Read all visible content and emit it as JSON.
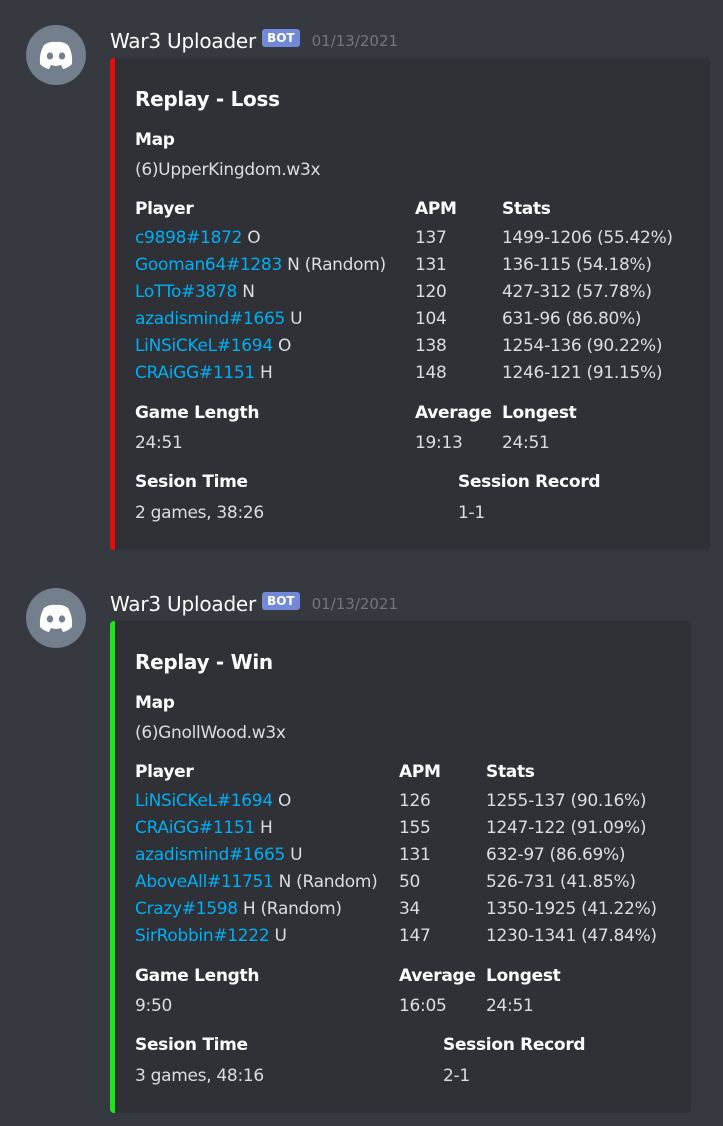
{
  "messages": [
    {
      "username": "War3 Uploader",
      "bot_tag": "BOT",
      "timestamp": "01/13/2021",
      "embed": {
        "color": "#e30f0f",
        "title": "Replay - Loss",
        "map_label": "Map",
        "map": "(6)UpperKingdom.w3x",
        "player_label": "Player",
        "apm_label": "APM",
        "stats_label": "Stats",
        "players": [
          {
            "name": "c9898#1872",
            "race": "O",
            "apm": "137",
            "stats": "1499-1206 (55.42%)"
          },
          {
            "name": "Gooman64#1283",
            "race": "N (Random)",
            "apm": "131",
            "stats": "136-115 (54.18%)"
          },
          {
            "name": "LoTTo#3878",
            "race": "N",
            "apm": "120",
            "stats": "427-312 (57.78%)"
          },
          {
            "name": "azadismind#1665",
            "race": "U",
            "apm": "104",
            "stats": "631-96 (86.80%)"
          },
          {
            "name": "LiNSiCKeL#1694",
            "race": "O",
            "apm": "138",
            "stats": "1254-136 (90.22%)"
          },
          {
            "name": "CRAiGG#1151",
            "race": "H",
            "apm": "148",
            "stats": "1246-121 (91.15%)"
          }
        ],
        "game_length_label": "Game Length",
        "game_length": "24:51",
        "average_label": "Average",
        "average": "19:13",
        "longest_label": "Longest",
        "longest": "24:51",
        "session_time_label": "Sesion Time",
        "session_time": "2 games, 38:26",
        "session_record_label": "Session Record",
        "session_record": "1-1"
      }
    },
    {
      "username": "War3 Uploader",
      "bot_tag": "BOT",
      "timestamp": "01/13/2021",
      "embed": {
        "color": "#1fe31f",
        "title": "Replay - Win",
        "map_label": "Map",
        "map": "(6)GnollWood.w3x",
        "player_label": "Player",
        "apm_label": "APM",
        "stats_label": "Stats",
        "players": [
          {
            "name": "LiNSiCKeL#1694",
            "race": "O",
            "apm": "126",
            "stats": "1255-137 (90.16%)"
          },
          {
            "name": "CRAiGG#1151",
            "race": "H",
            "apm": "155",
            "stats": "1247-122 (91.09%)"
          },
          {
            "name": "azadismind#1665",
            "race": "U",
            "apm": "131",
            "stats": "632-97 (86.69%)"
          },
          {
            "name": "AboveAll#11751",
            "race": "N (Random)",
            "apm": "50",
            "stats": "526-731 (41.85%)"
          },
          {
            "name": "Crazy#1598",
            "race": "H (Random)",
            "apm": "34",
            "stats": "1350-1925 (41.22%)"
          },
          {
            "name": "SirRobbin#1222",
            "race": "U",
            "apm": "147",
            "stats": "1230-1341 (47.84%)"
          }
        ],
        "game_length_label": "Game Length",
        "game_length": "9:50",
        "average_label": "Average",
        "average": "16:05",
        "longest_label": "Longest",
        "longest": "24:51",
        "session_time_label": "Sesion Time",
        "session_time": "3 games, 48:16",
        "session_record_label": "Session Record",
        "session_record": "2-1"
      }
    }
  ]
}
